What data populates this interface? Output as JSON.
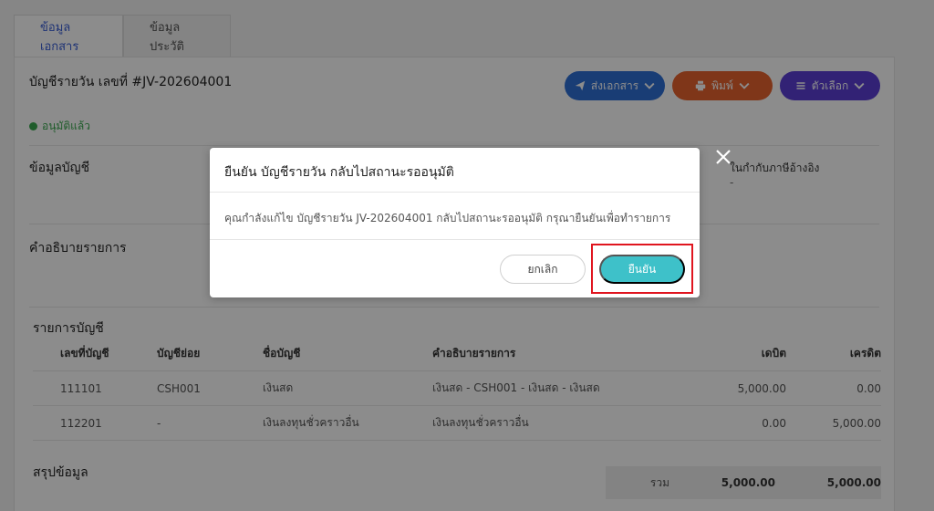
{
  "tabs": [
    {
      "label": "ข้อมูลเอกสาร",
      "active": true
    },
    {
      "label": "ข้อมูลประวัติ",
      "active": false
    }
  ],
  "document": {
    "title": "บัญชีรายวัน เลขที่ #JV-202604001",
    "status": "อนุมัติแล้ว",
    "status_color": "#3aa84f"
  },
  "actions": {
    "send_label": "ส่งเอกสาร",
    "print_label": "พิมพ์",
    "options_label": "ตัวเลือก",
    "send_color": "#2f6fd6",
    "print_color": "#e8632f",
    "options_color": "#5b3fd6"
  },
  "sections": {
    "account_info": "ข้อมูลบัญชี",
    "description": "คำอธิบายรายการ",
    "ref_label": "ในกำกับภาษีอ้างอิง",
    "ref_value": "-",
    "account_items": "รายการบัญชี",
    "summary": "สรุปข้อมูล"
  },
  "table": {
    "headers": [
      "เลขที่บัญชี",
      "บัญชีย่อย",
      "ชื่อบัญชี",
      "คำอธิบายรายการ",
      "เดบิต",
      "เครดิต"
    ],
    "rows": [
      [
        "111101",
        "CSH001",
        "เงินสด",
        "เงินสด - CSH001 - เงินสด - เงินสด",
        "5,000.00",
        "0.00"
      ],
      [
        "112201",
        "-",
        "เงินลงทุนชั่วคราวอื่น",
        "เงินลงทุนชั่วคราวอื่น",
        "0.00",
        "5,000.00"
      ]
    ]
  },
  "summary_row": {
    "label": "รวม",
    "debit": "5,000.00",
    "credit": "5,000.00"
  },
  "modal": {
    "title": "ยืนยัน บัญชีรายวัน กลับไปสถานะรออนุมัติ",
    "body": "คุณกำลังแก้ไข บัญชีรายวัน JV-202604001 กลับไปสถานะรออนุมัติ กรุณายืนยันเพื่อทำรายการ",
    "cancel_label": "ยกเลิก",
    "confirm_label": "ยืนยัน",
    "confirm_color": "#3ec1c9",
    "highlight_color": "#e0151f"
  }
}
